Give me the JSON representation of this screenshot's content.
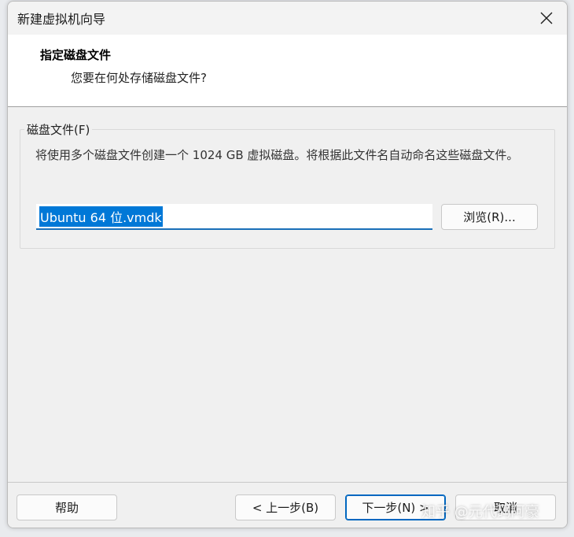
{
  "window": {
    "title": "新建虚拟机向导"
  },
  "header": {
    "title": "指定磁盘文件",
    "subtitle": "您要在何处存储磁盘文件?"
  },
  "disk_file": {
    "group_label": "磁盘文件(F)",
    "description": "将使用多个磁盘文件创建一个 1024 GB 虚拟磁盘。将根据此文件名自动命名这些磁盘文件。",
    "value": "Ubuntu 64 位.vmdk",
    "browse_label": "浏览(R)..."
  },
  "footer": {
    "help_label": "帮助",
    "back_label": "< 上一步(B)",
    "next_label": "下一步(N) >",
    "cancel_label": "取消"
  },
  "watermark": "知乎 @元代码阿豪",
  "icons": {
    "close": "close-icon"
  },
  "colors": {
    "accent": "#0078d7",
    "selection_text": "#ffffff"
  }
}
